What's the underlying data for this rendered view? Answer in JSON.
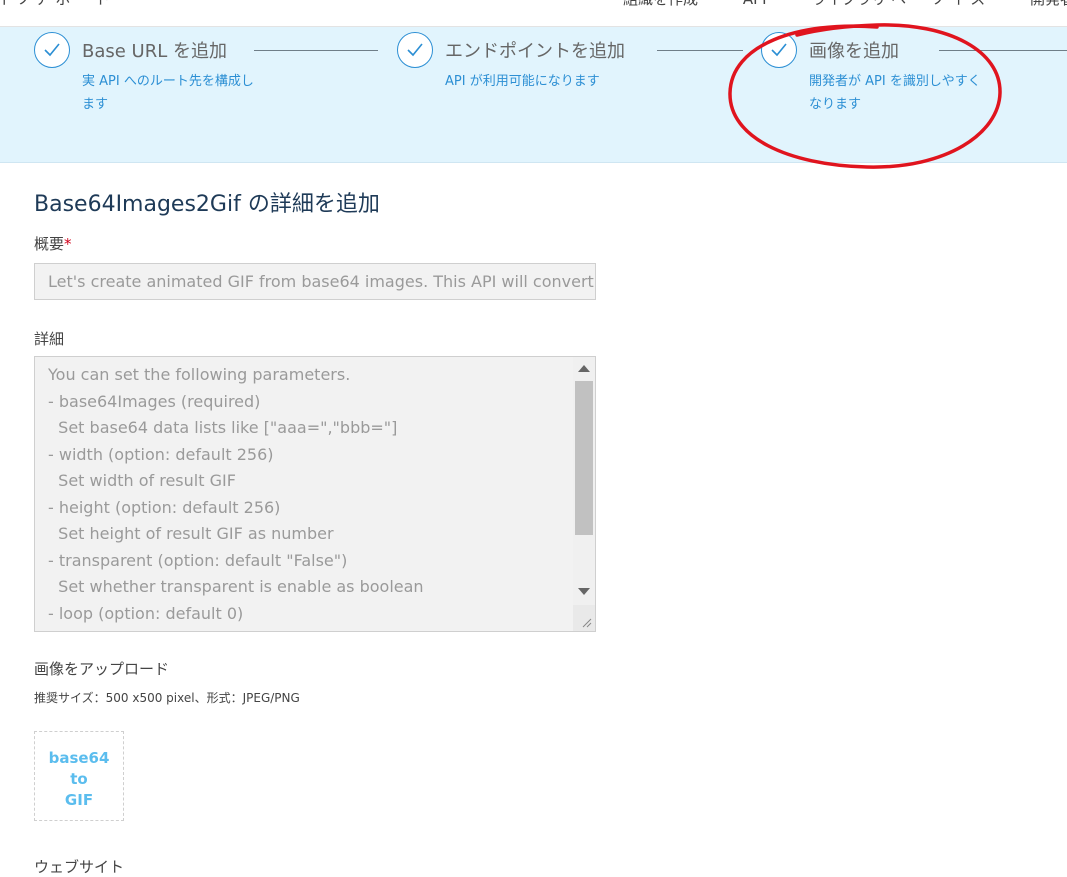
{
  "topbar": {
    "brand": "イ ソ ア ホ ー ト",
    "nav": [
      "組織を作成",
      "API",
      "ライブラリ ヘ ー ソ イ ス",
      "開発者"
    ]
  },
  "steps": [
    {
      "title": "Base URL を追加",
      "desc": "実 API へのルート先を構成します"
    },
    {
      "title": "エンドポイントを追加",
      "desc": "API が利用可能になります"
    },
    {
      "title": "画像を追加",
      "desc": "開発者が API を識別しやすくなります"
    }
  ],
  "page": {
    "title": "Base64Images2Gif の詳細を追加",
    "summary_label": "概要",
    "required_mark": "*",
    "summary_value": "Let's create animated GIF from base64 images. This API will convert",
    "details_label": "詳細",
    "details_lines": [
      "You can set the following parameters.",
      "- base64Images (required)",
      "  Set base64 data lists like [\"aaa=\",\"bbb=\"]",
      "- width (option: default 256)",
      "  Set width of result GIF",
      "- height (option: default 256)",
      "  Set height of result GIF as number",
      "- transparent (option: default \"False\")",
      "  Set whether transparent is enable as boolean",
      "- loop (option: default 0)"
    ],
    "upload_label": "画像をアップロード",
    "upload_hint": "推奨サイズ：500 x500 pixel、形式：JPEG/PNG",
    "logo_text": "base64 to GIF",
    "website_label": "ウェブサイト"
  },
  "colors": {
    "accent": "#2c8fd4",
    "stepper_bg": "#e1f4fd",
    "annotation": "#e0141e",
    "logo_text": "#5bbdee"
  },
  "icons": [
    "check-icon",
    "scroll-up-arrow-icon",
    "scroll-down-arrow-icon",
    "resize-grip-icon"
  ]
}
